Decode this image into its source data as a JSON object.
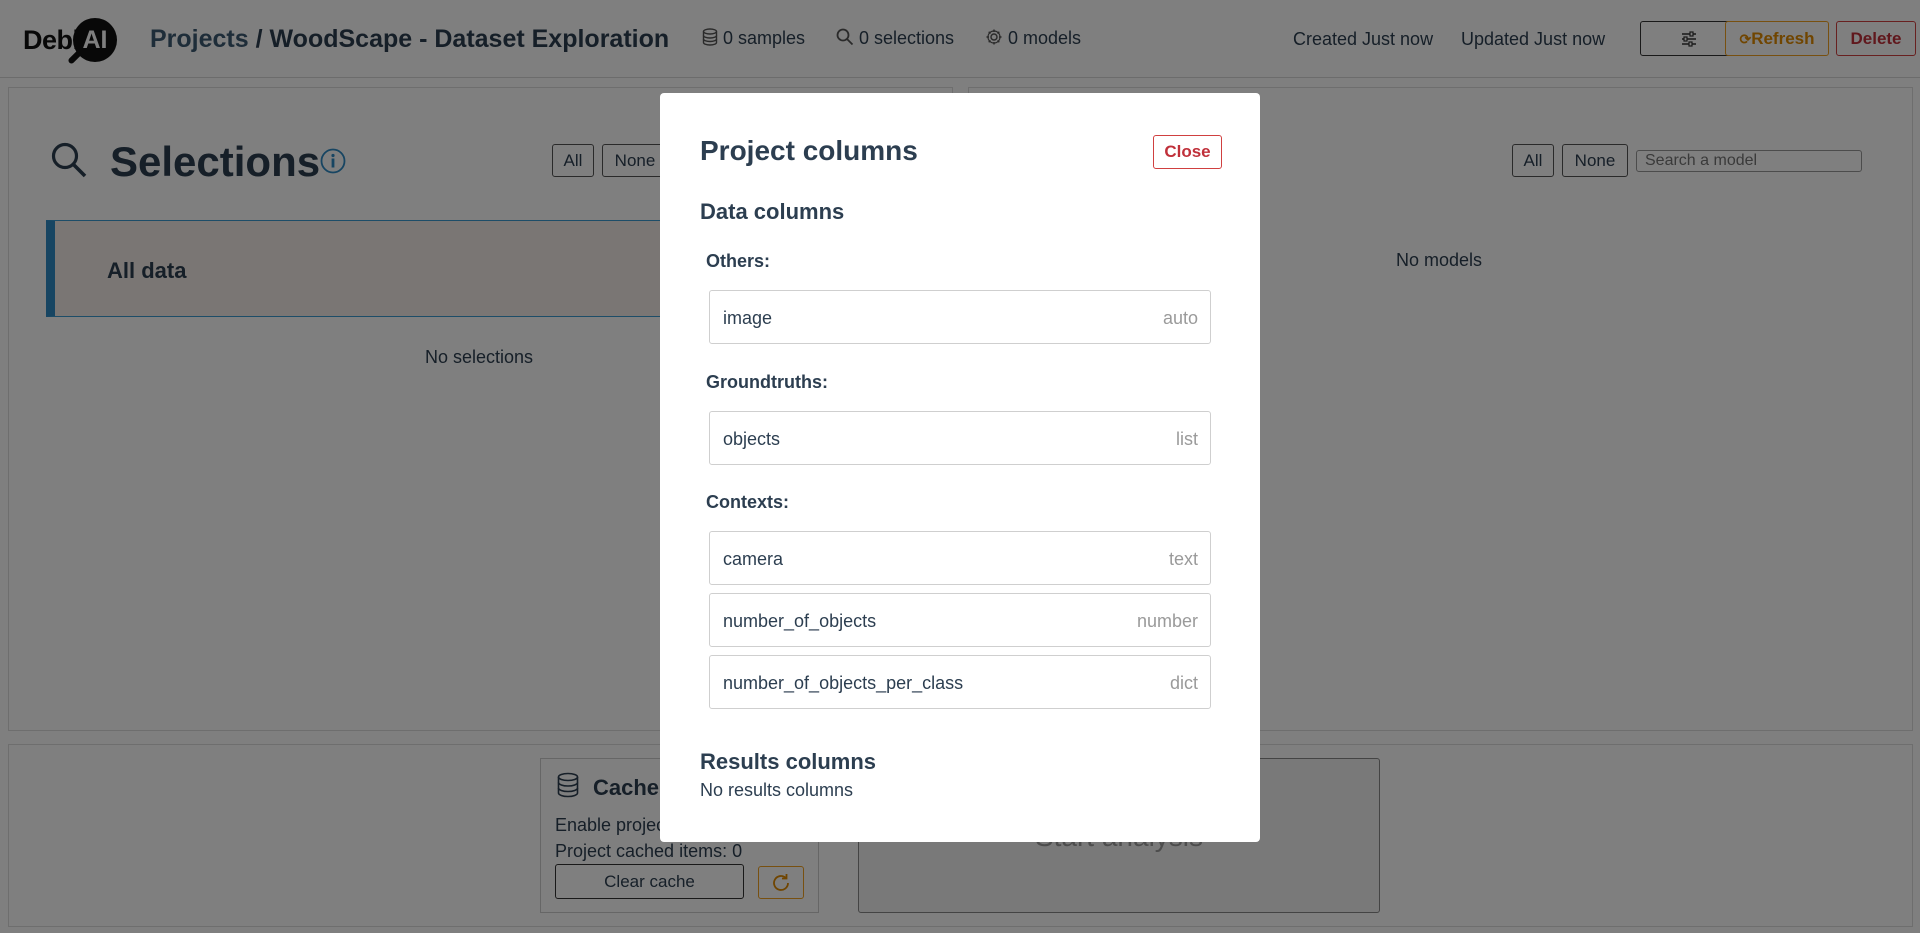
{
  "header": {
    "logo_text": "Debi",
    "logo_badge": "AI",
    "breadcrumb_projects": "Projects",
    "breadcrumb_separator": "/",
    "project_name": "WoodScape - Dataset Exploration",
    "samples": "0 samples",
    "selections": "0 selections",
    "models": "0 models",
    "created": "Created Just now",
    "updated": "Updated Just now",
    "refresh_label": "Refresh",
    "delete_label": "Delete"
  },
  "selections_panel": {
    "title": "Selections",
    "all_label": "All",
    "none_label": "None",
    "all_data_label": "All data",
    "empty_text": "No selections"
  },
  "models_panel": {
    "all_label": "All",
    "none_label": "None",
    "search_placeholder": "Search a model",
    "empty_text": "No models"
  },
  "cache": {
    "title": "Cache",
    "enable_text": "Enable projec",
    "cached_items_text": "Project cached items: 0",
    "clear_label": "Clear cache"
  },
  "analysis": {
    "start_label": "Start analysis"
  },
  "modal": {
    "title": "Project columns",
    "close_label": "Close",
    "data_columns_heading": "Data columns",
    "groups": [
      {
        "label": "Others:",
        "columns": [
          {
            "name": "image",
            "type": "auto"
          }
        ]
      },
      {
        "label": "Groundtruths:",
        "columns": [
          {
            "name": "objects",
            "type": "list"
          }
        ]
      },
      {
        "label": "Contexts:",
        "columns": [
          {
            "name": "camera",
            "type": "text"
          },
          {
            "name": "number_of_objects",
            "type": "number"
          },
          {
            "name": "number_of_objects_per_class",
            "type": "dict"
          }
        ]
      }
    ],
    "results_columns_heading": "Results columns",
    "results_empty_text": "No results columns"
  },
  "colors": {
    "accent_blue": "#2f8bc5",
    "refresh_orange": "#e08a00",
    "delete_red": "#c0303a",
    "text_dark": "#2c3e50"
  },
  "icons": [
    "database-icon",
    "search-icon",
    "gear-icon",
    "settings-sliders-icon",
    "refresh-icon",
    "info-icon",
    "cache-database-icon"
  ]
}
